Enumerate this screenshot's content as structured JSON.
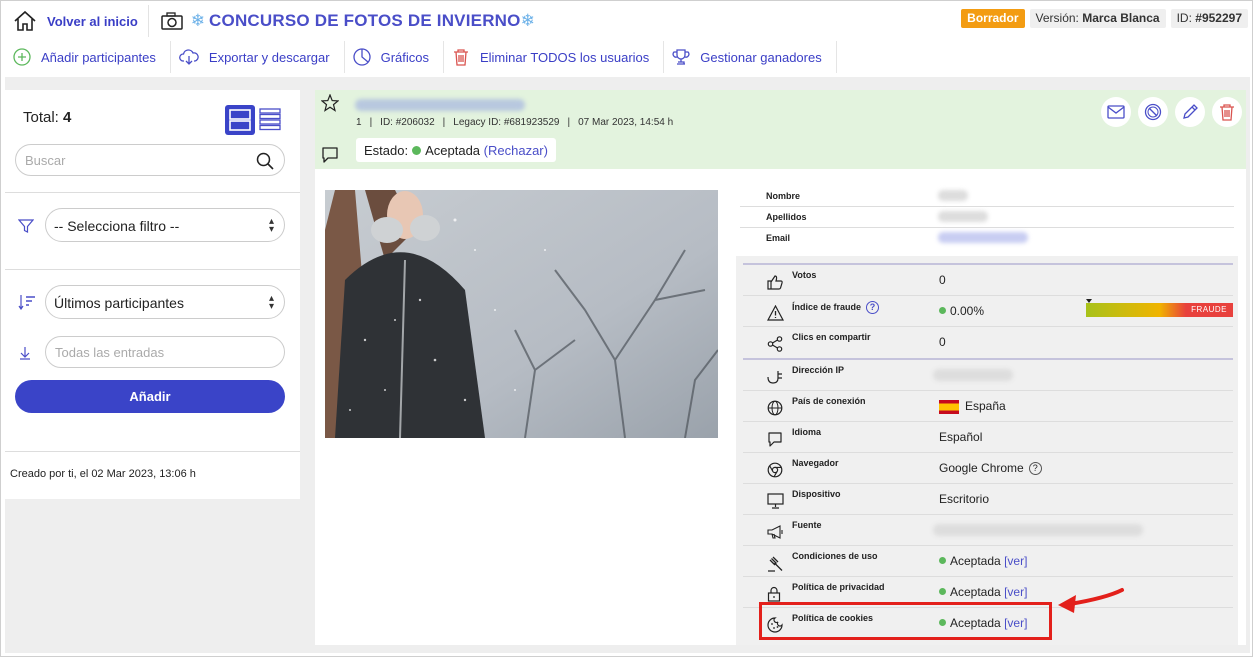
{
  "header": {
    "home_label": "Volver al inicio",
    "title": "CONCURSO DE FOTOS DE INVIERNO",
    "status_badge": "Borrador",
    "version_label": "Versión:",
    "version_value": "Marca Blanca",
    "id_label": "ID:",
    "id_value": "#952297"
  },
  "toolbar": {
    "items": [
      {
        "label": "Añadir participantes",
        "icon": "plus-circle-icon"
      },
      {
        "label": "Exportar y descargar",
        "icon": "cloud-download-icon"
      },
      {
        "label": "Gráficos",
        "icon": "pie-chart-icon"
      },
      {
        "label": "Eliminar TODOS los usuarios",
        "icon": "trash-icon"
      },
      {
        "label": "Gestionar ganadores",
        "icon": "trophy-icon"
      }
    ]
  },
  "sidebar": {
    "total_label": "Total:",
    "total_value": "4",
    "search_placeholder": "Buscar",
    "filter_select": "-- Selecciona filtro --",
    "sort_select": "Últimos participantes",
    "entries_placeholder": "Todas las entradas",
    "add_button": "Añadir",
    "created": "Creado por ti, el 02 Mar 2023, 13:06 h"
  },
  "entry": {
    "number": "1",
    "id": "ID: #206032",
    "legacy_id": "Legacy ID: #681923529",
    "date": "07 Mar 2023, 14:54 h",
    "estado_label": "Estado:",
    "estado_value": "Aceptada",
    "reject_link": "(Rechazar)",
    "fields": [
      {
        "label": "Nombre"
      },
      {
        "label": "Apellidos"
      },
      {
        "label": "Email"
      }
    ],
    "stats": {
      "votos_label": "Votos",
      "votos_value": "0",
      "fraude_label": "Índice de fraude",
      "fraude_value": "0.00%",
      "fraude_bar_label": "FRAUDE",
      "clics_label": "Clics en compartir",
      "clics_value": "0",
      "ip_label": "Dirección IP",
      "pais_label": "País de conexión",
      "pais_value": "España",
      "idioma_label": "Idioma",
      "idioma_value": "Español",
      "navegador_label": "Navegador",
      "navegador_value": "Google Chrome",
      "dispositivo_label": "Dispositivo",
      "dispositivo_value": "Escritorio",
      "fuente_label": "Fuente",
      "condiciones_label": "Condiciones de uso",
      "condiciones_value": "Aceptada",
      "privacidad_label": "Política de privacidad",
      "privacidad_value": "Aceptada",
      "cookies_label": "Política de cookies",
      "cookies_value": "Aceptada",
      "ver_link": "[ver]"
    }
  },
  "colors": {
    "accent": "#3a44c8",
    "badge_orange": "#f39c12",
    "accepted": "#5cb85c",
    "highlight": "#e3201b"
  }
}
